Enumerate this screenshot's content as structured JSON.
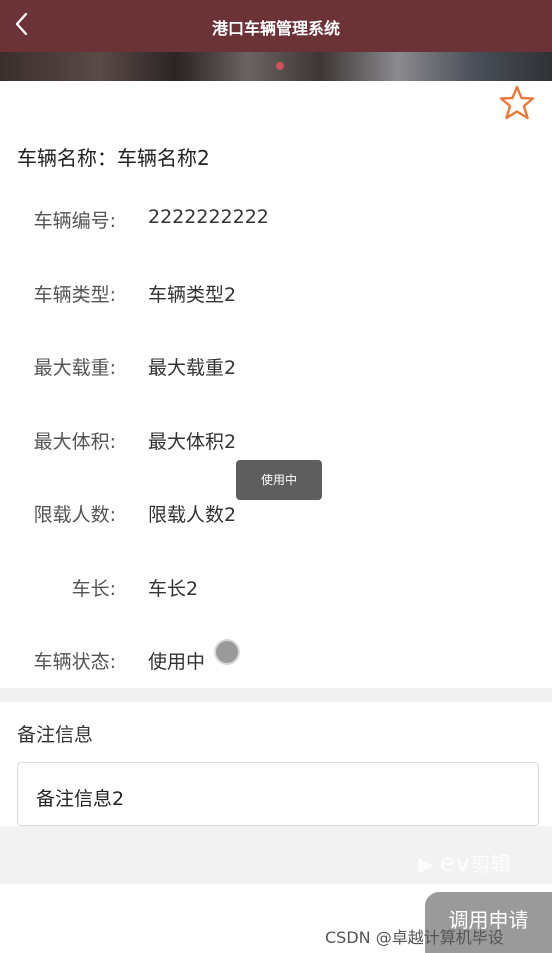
{
  "header": {
    "title": "港口车辆管理系统",
    "back_icon": "chevron-left-icon"
  },
  "favorite": {
    "icon": "star-outline-icon",
    "color": "#e8793a"
  },
  "vehicle_name": {
    "label": "车辆名称：",
    "value": "车辆名称2"
  },
  "fields": [
    {
      "label": "车辆编号:",
      "value": "2222222222"
    },
    {
      "label": "车辆类型:",
      "value": "车辆类型2"
    },
    {
      "label": "最大载重:",
      "value": "最大载重2"
    },
    {
      "label": "最大体积:",
      "value": "最大体积2"
    },
    {
      "label": "限载人数:",
      "value": "限载人数2"
    },
    {
      "label": "车长:",
      "value": "车长2"
    },
    {
      "label": "车辆状态:",
      "value": "使用中"
    }
  ],
  "tooltip": "使用中",
  "remark": {
    "title": "备注信息",
    "value": "备注信息2"
  },
  "apply_button": "调用申请",
  "overlay_logo": {
    "ev": "ev",
    "text": "剪辑"
  },
  "watermark": "CSDN @卓越计算机毕设",
  "colors": {
    "header_bg": "#6b3238",
    "star": "#e8793a",
    "button_bg": "#9a9a9a"
  }
}
